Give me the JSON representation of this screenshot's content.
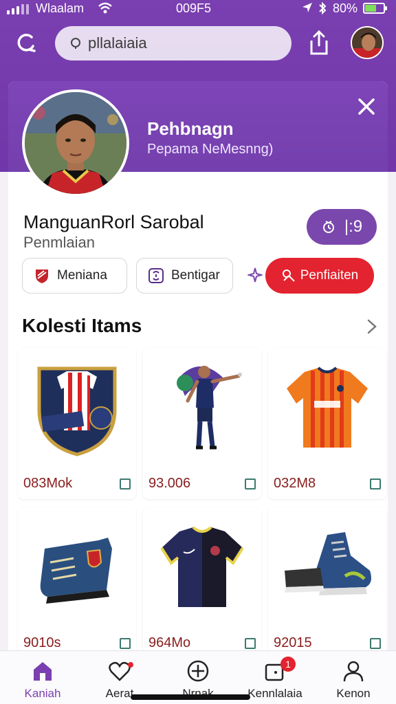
{
  "status_bar": {
    "carrier": "Wlaalam",
    "time": "009F5",
    "battery": "80%",
    "battery_color": "#7ee05a"
  },
  "header": {
    "search_placeholder": "pllalaiaia",
    "back_icon": "refresh-back-icon",
    "share_icon": "share-icon"
  },
  "profile": {
    "card_title": "Pehbnagn",
    "card_subtitle": "Pepama NeMesnng)",
    "name": "ManguanRorl Sarobal",
    "role": "Penmlaian",
    "stat_value": "|:9",
    "accent": "#7a47ad"
  },
  "actions": {
    "button1": "Meniana",
    "button2": "Bentigar",
    "primary": "Penfiaiten",
    "primary_color": "#e3232f"
  },
  "collection": {
    "title": "Kolesti Itams",
    "items": [
      {
        "price": "083Mok",
        "kind": "club-crest"
      },
      {
        "price": "93.006",
        "kind": "player-figure"
      },
      {
        "price": "032M8",
        "kind": "orange-jersey"
      },
      {
        "price": "9010s",
        "kind": "blue-boot"
      },
      {
        "price": "964Mo",
        "kind": "navy-jersey"
      },
      {
        "price": "92015",
        "kind": "sneaker"
      }
    ]
  },
  "bottom_nav": {
    "items": [
      {
        "label": "Kaniah",
        "icon": "home-icon"
      },
      {
        "label": "Aerat",
        "icon": "heart-icon"
      },
      {
        "label": "Nrnak",
        "icon": "plus-circle-icon"
      },
      {
        "label": "Kennlalaia",
        "icon": "wallet-icon",
        "badge": "1"
      },
      {
        "label": "Kenon",
        "icon": "person-icon"
      }
    ]
  }
}
